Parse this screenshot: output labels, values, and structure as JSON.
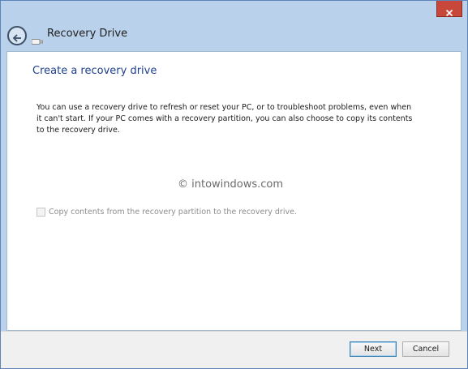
{
  "window": {
    "title": "Recovery Drive"
  },
  "content": {
    "heading": "Create a recovery drive",
    "description": "You can use a recovery drive to refresh or reset your PC, or to troubleshoot problems, even when it can't start. If your PC comes with a recovery partition, you can also choose to copy its contents to the recovery drive.",
    "watermark": "© intowindows.com",
    "checkbox": {
      "label": "Copy contents from the recovery partition to the recovery drive.",
      "checked": false,
      "enabled": false
    }
  },
  "footer": {
    "next_label": "Next",
    "cancel_label": "Cancel"
  },
  "icons": {
    "close": "close-icon",
    "back": "back-arrow-icon",
    "drive": "usb-drive-icon"
  },
  "colors": {
    "chrome": "#b9d1ea",
    "close_button": "#c7473a",
    "heading": "#1e3f8f"
  }
}
